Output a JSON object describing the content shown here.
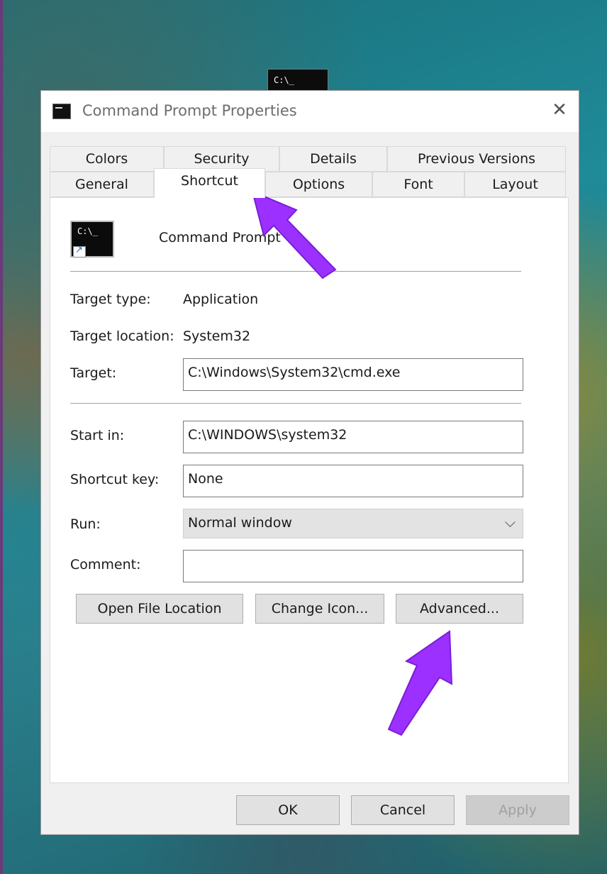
{
  "dialog": {
    "title": "Command Prompt Properties",
    "close_glyph": "✕"
  },
  "taskbar_icon": {
    "text": "C:\\_"
  },
  "tabs": {
    "row1": [
      "Colors",
      "Security",
      "Details",
      "Previous Versions"
    ],
    "row2": [
      "General",
      "Shortcut",
      "Options",
      "Font",
      "Layout"
    ],
    "active": "Shortcut"
  },
  "shortcut": {
    "icon_prompt": "C:\\_",
    "name": "Command Prompt",
    "target_type_label": "Target type:",
    "target_type_value": "Application",
    "target_location_label": "Target location:",
    "target_location_value": "System32",
    "target_label": "Target:",
    "target_value": "C:\\Windows\\System32\\cmd.exe",
    "start_in_label": "Start in:",
    "start_in_value": "C:\\WINDOWS\\system32",
    "shortcut_key_label": "Shortcut key:",
    "shortcut_key_value": "None",
    "run_label": "Run:",
    "run_value": "Normal window",
    "comment_label": "Comment:",
    "comment_value": ""
  },
  "buttons": {
    "open_file_location": "Open File Location",
    "change_icon": "Change Icon...",
    "advanced": "Advanced...",
    "ok": "OK",
    "cancel": "Cancel",
    "apply": "Apply"
  },
  "icons": {
    "dropdown": "chevron-down-icon",
    "close": "close-icon",
    "annotation": "purple-arrow"
  },
  "colors": {
    "annotation_arrow": "#9b30ff",
    "dialog_bg": "#f0f0f0",
    "panel_bg": "#ffffff"
  }
}
